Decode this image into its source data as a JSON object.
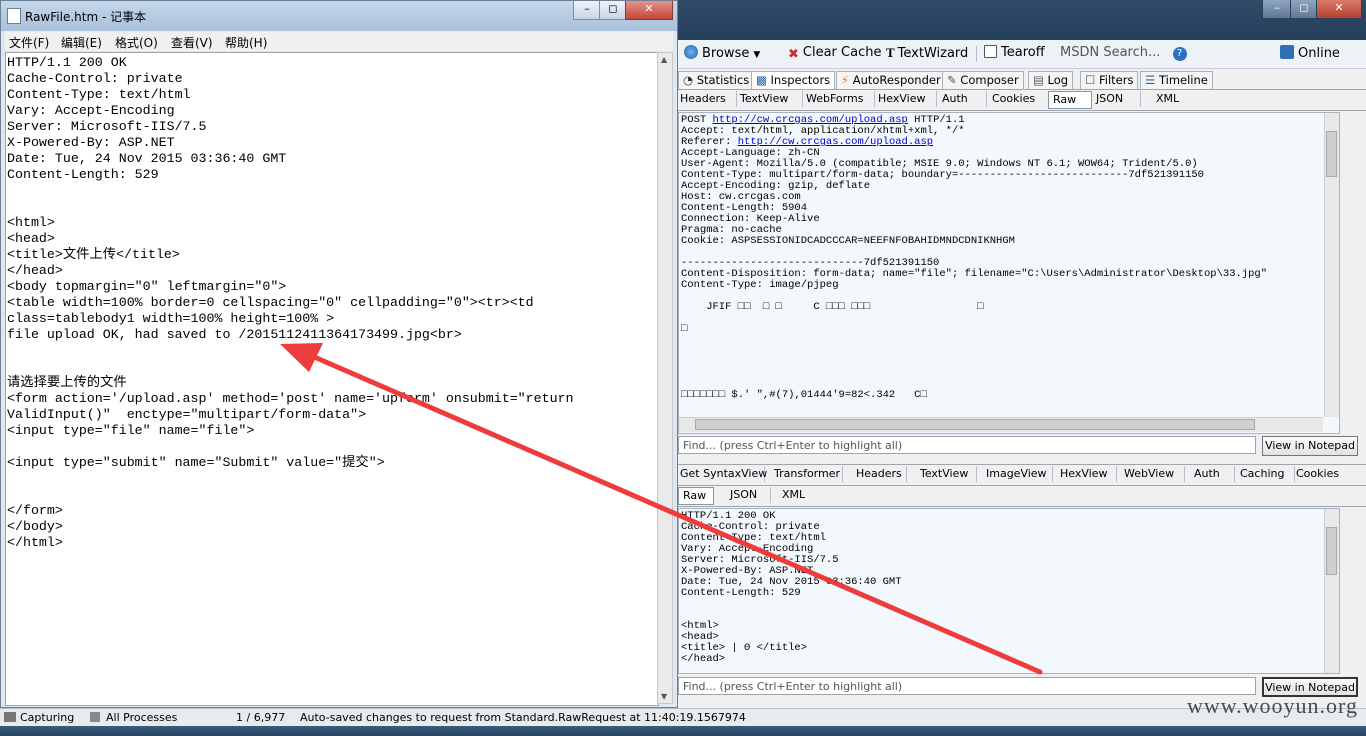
{
  "notepad": {
    "title": "RawFile.htm - 记事本",
    "menu": [
      "文件(F)",
      "编辑(E)",
      "格式(O)",
      "查看(V)",
      "帮助(H)"
    ],
    "content": "HTTP/1.1 200 OK\nCache-Control: private\nContent-Type: text/html\nVary: Accept-Encoding\nServer: Microsoft-IIS/7.5\nX-Powered-By: ASP.NET\nDate: Tue, 24 Nov 2015 03:36:40 GMT\nContent-Length: 529\n\n\n<html>\n<head>\n<title>文件上传</title>\n</head>\n<body topmargin=\"0\" leftmargin=\"0\">\n<table width=100% border=0 cellspacing=\"0\" cellpadding=\"0\"><tr><td\nclass=tablebody1 width=100% height=100% >\nfile upload OK, had saved to /2015112411364173499.jpg<br>\n\n\n请选择要上传的文件\n<form action='/upload.asp' method='post' name='upform' onsubmit=\"return\nValidInput()\"  enctype=\"multipart/form-data\">\n<input type=\"file\" name=\"file\">\n\n<input type=\"submit\" name=\"Submit\" value=\"提交\">\n\n\n</form>\n</body>\n</html>"
  },
  "fiddler": {
    "toolbar": {
      "browse": "Browse",
      "clear_cache": "Clear Cache",
      "textwizard": "TextWizard",
      "tearoff": "Tearoff",
      "msdn_search": "MSDN Search...",
      "online": "Online"
    },
    "main_tabs": [
      "Statistics",
      "Inspectors",
      "AutoResponder",
      "Composer",
      "Log",
      "Filters",
      "Timeline"
    ],
    "request_tabs": [
      "Headers",
      "TextView",
      "WebForms",
      "HexView",
      "Auth",
      "Cookies",
      "Raw",
      "JSON",
      "XML"
    ],
    "request": {
      "line_method": "POST ",
      "line_url": "http://cw.crcgas.com/upload.asp",
      "line_proto": " HTTP/1.1",
      "accept": "Accept: text/html, application/xhtml+xml, */*",
      "referer_label": "Referer: ",
      "referer_url": "http://cw.crcgas.com/upload.asp",
      "rest": "Accept-Language: zh-CN\nUser-Agent: Mozilla/5.0 (compatible; MSIE 9.0; Windows NT 6.1; WOW64; Trident/5.0)\nContent-Type: multipart/form-data; boundary=---------------------------7df521391150\nAccept-Encoding: gzip, deflate\nHost: cw.crcgas.com\nContent-Length: 5904\nConnection: Keep-Alive\nPragma: no-cache\nCookie: ASPSESSIONIDCADCCCAR=NEEFNFOBAHIDMNDCDNIKNHGM\n\n-----------------------------7df521391150\nContent-Disposition: form-data; name=\"file\"; filename=\"C:\\Users\\Administrator\\Desktop\\33.jpg\"\nContent-Type: image/pjpeg\n\n    JFIF □□  □ □     C □□□ □□□                 □\n\n□\n\n\n\n\n\n□□□□□□□ $.' \",#(7),01444'9=82<.342   C□\n\n\n\n-"
    },
    "find_placeholder": "Find... (press Ctrl+Enter to highlight all)",
    "view_in_notepad": "View in Notepad",
    "response_tabs": [
      "Get SyntaxView",
      "Transformer",
      "Headers",
      "TextView",
      "ImageView",
      "HexView",
      "WebView",
      "Auth",
      "Caching",
      "Cookies"
    ],
    "response_subtabs": [
      "Raw",
      "JSON",
      "XML"
    ],
    "response": "HTTP/1.1 200 OK\nCache-Control: private\nContent-Type: text/html\nVary: Accept-Encoding\nServer: Microsoft-IIS/7.5\nX-Powered-By: ASP.NET\nDate: Tue, 24 Nov 2015 03:36:40 GMT\nContent-Length: 529\n\n\n<html>\n<head>\n<title> | Θ </title>\n</head>"
  },
  "statusbar": {
    "capturing": "Capturing",
    "processes": "All Processes",
    "count": "1 / 6,977",
    "message": "Auto-saved changes to request from Standard.RawRequest at 11:40:19.1567974"
  },
  "watermark": "www.wooyun.org",
  "colors": {
    "arrow": "#ee3b3b",
    "link": "#0000cc",
    "pane_bg": "#f2f8fc"
  }
}
